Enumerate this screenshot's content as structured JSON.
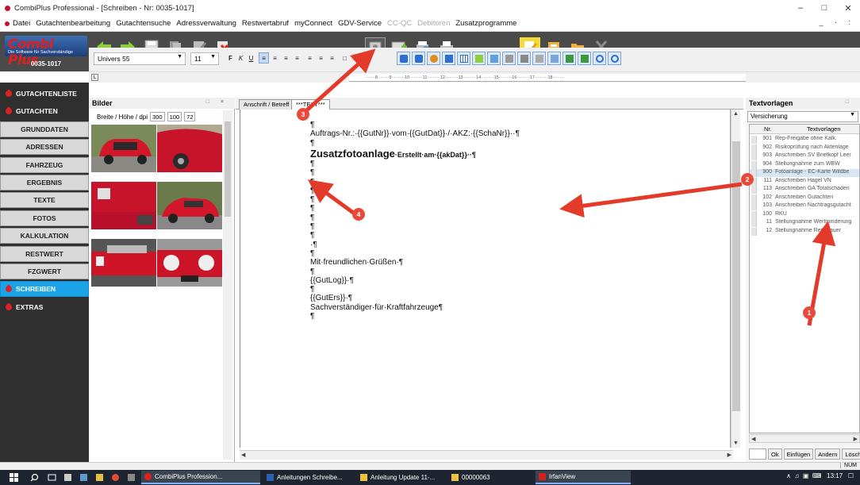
{
  "window": {
    "title": "CombiPlus Professional - [Schreiben - Nr: 0035-1017]",
    "controls": [
      "–",
      "□",
      "✕"
    ]
  },
  "menu": {
    "items": [
      "Datei",
      "Gutachtenbearbeitung",
      "Gutachtensuche",
      "Adressverwaltung",
      "Restwertabruf",
      "myConnect",
      "GDV-Service",
      "CC-QC",
      "Debitoren",
      "Zusatzprogramme"
    ],
    "disabled": [
      "CC-QC",
      "Debitoren"
    ],
    "mdi_controls": "_ · :"
  },
  "logo": {
    "name": "Combi Plus",
    "tagline": "Die Software für Sachverständige",
    "case_number": "0035-1017"
  },
  "format": {
    "font": "Univers 55",
    "size": "11",
    "buttons": [
      "F",
      "K",
      "U"
    ]
  },
  "nav": {
    "items": [
      {
        "label": "GUTACHTENLISTE",
        "style": "dark"
      },
      {
        "label": "GUTACHTEN",
        "style": "dark"
      },
      {
        "label": "GRUNDDATEN",
        "style": "normal"
      },
      {
        "label": "ADRESSEN",
        "style": "normal"
      },
      {
        "label": "FAHRZEUG",
        "style": "normal"
      },
      {
        "label": "ERGEBNIS",
        "style": "normal"
      },
      {
        "label": "TEXTE",
        "style": "normal"
      },
      {
        "label": "FOTOS",
        "style": "normal"
      },
      {
        "label": "KALKULATION",
        "style": "normal"
      },
      {
        "label": "RESTWERT",
        "style": "normal"
      },
      {
        "label": "FZGWERT",
        "style": "normal"
      },
      {
        "label": "SCHREIBEN",
        "style": "active"
      },
      {
        "label": "EXTRAS",
        "style": "dark"
      }
    ]
  },
  "bilder": {
    "title": "Bilder",
    "dim_label": "Breite / Höhe / dpi",
    "width": "300",
    "height": "100",
    "dpi": "72"
  },
  "editor": {
    "tabs": [
      "Anschrift / Betreff",
      "***TEXT***"
    ],
    "active_tab": 1,
    "lines": [
      {
        "text": "¶",
        "style": "normal"
      },
      {
        "text": "Auftrags-Nr.:·{{GutNr}}·vom·{{GutDat}}·/·AKZ:·{{SchaNr}}··¶",
        "style": "normal"
      },
      {
        "text": "¶",
        "style": "normal"
      },
      {
        "text": "Zusatzfotoanlage",
        "tail": "·Erstellt·am·{{akDat}}··¶",
        "style": "heading"
      },
      {
        "text": "¶",
        "style": "normal"
      },
      {
        "text": "¶",
        "style": "normal"
      },
      {
        "text": "¶",
        "style": "normal"
      },
      {
        "text": "¶",
        "style": "normal"
      },
      {
        "text": "¶",
        "style": "normal"
      },
      {
        "text": "¶",
        "style": "normal"
      },
      {
        "text": "¶",
        "style": "normal"
      },
      {
        "text": "¶",
        "style": "normal"
      },
      {
        "text": "¶",
        "style": "normal"
      },
      {
        "text": "·¶",
        "style": "normal"
      },
      {
        "text": "¶",
        "style": "normal"
      },
      {
        "text": "Mit·freundlichen·Grüßen·¶",
        "style": "normal"
      },
      {
        "text": "¶",
        "style": "normal"
      },
      {
        "text": "{{GutLog}}·¶",
        "style": "normal"
      },
      {
        "text": "¶",
        "style": "normal"
      },
      {
        "text": "{{GutErs}}·¶",
        "style": "normal"
      },
      {
        "text": "Sachverständiger·für·Kraftfahrzeuge¶",
        "style": "normal"
      },
      {
        "text": "¶",
        "style": "normal"
      }
    ]
  },
  "textvorlagen": {
    "title": "Textvorlagen",
    "category": "Versicherung",
    "col_nr": "Nr.",
    "col_text": "Textvorlagen",
    "rows": [
      {
        "nr": "901",
        "text": "Rep-Freigabe ohne Kalk."
      },
      {
        "nr": "902",
        "text": "Risikoprüfung nach Aktenlage"
      },
      {
        "nr": "903",
        "text": "Anschreiben SV Briefkopf Leer"
      },
      {
        "nr": "904",
        "text": "Stellungnahme zum WBW"
      },
      {
        "nr": "900",
        "text": "Fotoanlage - EC-Karte Wildbe"
      },
      {
        "nr": "111",
        "text": "Anschreiben Hagel VN"
      },
      {
        "nr": "113",
        "text": "Anschreiben GA Totalschaden"
      },
      {
        "nr": "102",
        "text": "Anschreiben Gutachten"
      },
      {
        "nr": "103",
        "text": "Anschreiben Nachtragsgutacht"
      },
      {
        "nr": "100",
        "text": "RKU"
      },
      {
        "nr": "11",
        "text": "Stellungnahme Wertminderung"
      },
      {
        "nr": "12",
        "text": "Stellungnahme Rep-Dauer"
      }
    ],
    "selected_index": 4,
    "buttons": [
      "Ok",
      "Einfügen",
      "Andern",
      "Löschen"
    ]
  },
  "status": {
    "num": "NUM"
  },
  "taskbar": {
    "tasks": [
      "CombiPlus Profession...",
      "Anleitungen Schreibe...",
      "Anleitung Update 11-...",
      "00000063",
      "IrfanView"
    ],
    "time": "13:17"
  },
  "annotations": [
    "1",
    "2",
    "3",
    "4"
  ],
  "colors": {
    "accent_blue": "#1aa3e8",
    "brand_red": "#e02020",
    "annotation_red": "#e84b3c",
    "toolbar_bg": "#4a4a4a"
  }
}
